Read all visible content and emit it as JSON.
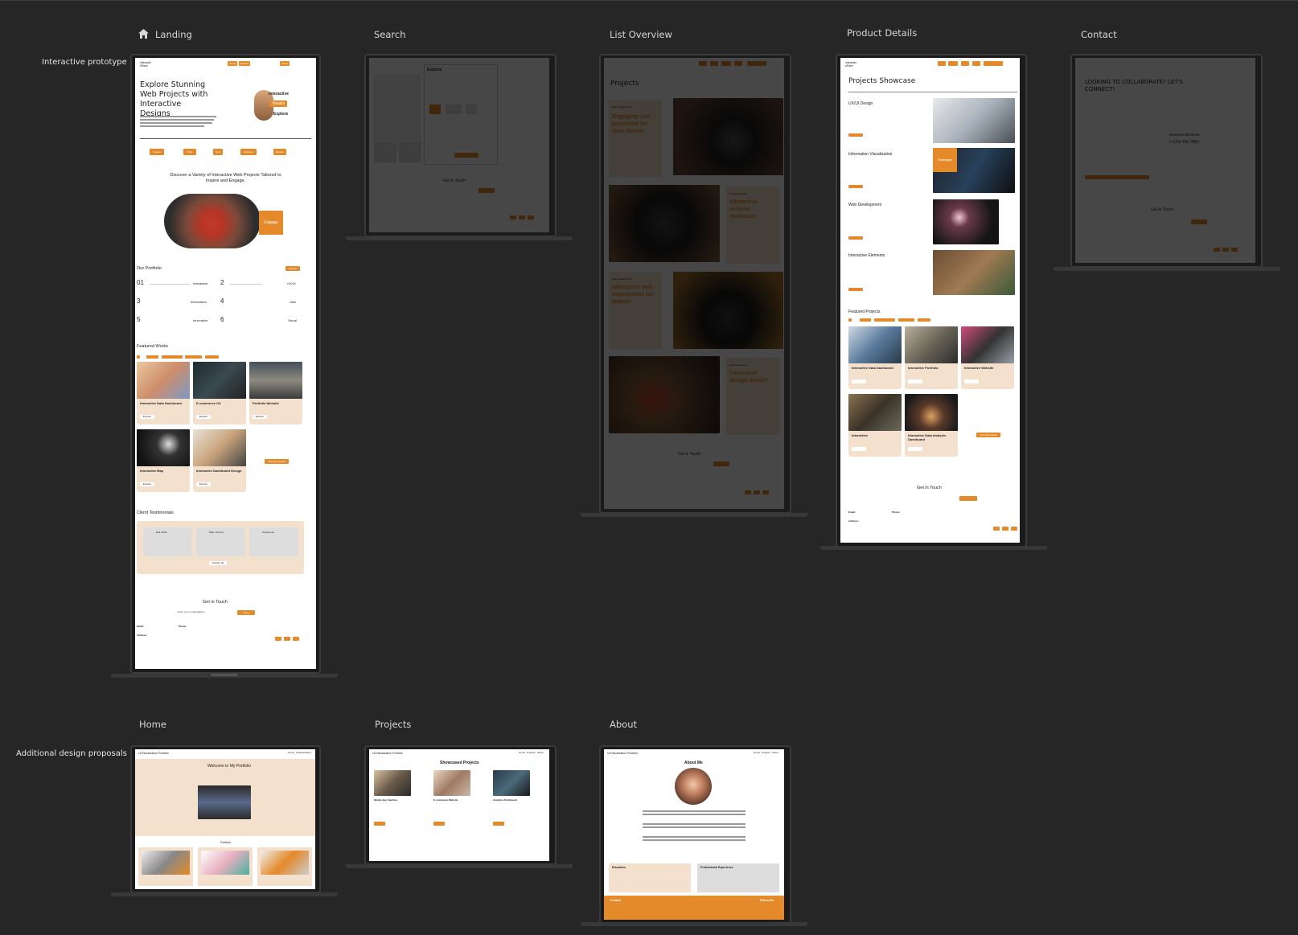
{
  "rows": {
    "interactive": "Interactive prototype",
    "additional": "Additional design proposals"
  },
  "sections": {
    "landing": "Landing",
    "search": "Search",
    "list_overview": "List Overview",
    "product_details": "Product Details",
    "contact": "Contact",
    "home": "Home",
    "projects": "Projects",
    "about": "About"
  },
  "colors": {
    "accent": "#e48a2a",
    "peach": "#f3e1cd",
    "canvas": "#262626"
  },
  "landing": {
    "brand": "interactiv sPace",
    "nav": [
      "Home",
      "Projects",
      "About"
    ],
    "hero_title": "Explore Stunning Web Projects with Interactive Designs",
    "hero_badges": [
      "Interactive",
      "Visuals",
      "Explore"
    ],
    "tools": [
      "Search",
      "Filter",
      "Sort",
      "Discover",
      "Explore"
    ],
    "discover": "Discover a Variety of Interactive Web Projects Tailored to Inspire and Engage.",
    "engage": "Engage",
    "portfolio_title": "Our Portfolio",
    "portfolio_btn": "Explore",
    "portfolio": [
      {
        "n": "01",
        "label": "Interactive"
      },
      {
        "n": "2",
        "label": "UX/UI"
      },
      {
        "n": "3",
        "label": "Information"
      },
      {
        "n": "4",
        "label": "User"
      },
      {
        "n": "5",
        "label": "Innovative"
      },
      {
        "n": "6",
        "label": "Visual"
      }
    ],
    "featured_title": "Featured Works",
    "works": [
      "Interactive Data Dashboard",
      "E-commerce UX",
      "Portfolio Website",
      "Interactive Map",
      "Interactive Dashboard Design"
    ],
    "explore": "Explore",
    "view_all": "View all projects",
    "testimonials_title": "Client Testimonials",
    "testimonials": [
      "Eva Smith",
      "Mike Johnson",
      "Sophia Lee"
    ],
    "explore_all": "Explore all",
    "get_in_touch": "Get in Touch",
    "email_placeholder": "Enter your email address",
    "send": "Send",
    "email_label": "Email:",
    "phone_label": "Phone:",
    "address_label": "Address:"
  },
  "search": {
    "panel_title": "Explore",
    "get_in_touch": "Get in Touch"
  },
  "list": {
    "title": "Projects",
    "cards": [
      {
        "tag": "Data Visualization",
        "text": "Engaging user interfaces for data stories"
      },
      {
        "tag": "Creative Designs",
        "text": "Interactive website showcase"
      },
      {
        "tag": "Web Development",
        "text": "Interactive web experiences for brands"
      },
      {
        "tag": "User Experience",
        "text": "Innovative design launch"
      }
    ],
    "get_in_touch": "Get in Touch"
  },
  "details": {
    "title": "Projects Showcase",
    "items": [
      "UX/UI Design",
      "Information Visualization",
      "Web Development",
      "Interactive Elements"
    ],
    "strategies": "Strategies",
    "featured_title": "Featured Projects",
    "featured": [
      "Interactive Data Dashboard",
      "Interactive Portfolio",
      "Interactive Website",
      "Interactive",
      "Interactive Data Analysis Dashboard"
    ],
    "view_all": "View all projects",
    "get_in_touch": "Get in Touch",
    "email_label": "Email:",
    "phone_label": "Phone:",
    "address_label": "Address:"
  },
  "contact": {
    "headline": "LOOKING TO COLLABORATE? LET'S CONNECT!",
    "email": "developer@interac",
    "phone": "(+123) 456 7890",
    "get_in_touch": "Get in Touch"
  },
  "home": {
    "brand": "UI/Visualization Portfolio",
    "nav": [
      "Home",
      "Projects",
      "About"
    ],
    "welcome": "Welcome to My Portfolio",
    "portfolio": "Portfolio"
  },
  "projects_page": {
    "brand": "UI/Visualization Portfolio",
    "nav": [
      "Home",
      "Projects",
      "About"
    ],
    "title": "Showcased Projects",
    "cards": [
      "Mobile App Interface",
      "E-commerce Website",
      "Analytics Dashboard"
    ]
  },
  "about": {
    "brand": "UI/Visualization Portfolio",
    "nav": [
      "Home",
      "Projects",
      "About"
    ],
    "title": "About Me",
    "education": "Education",
    "experience": "Professional Experience",
    "contact": "Contact",
    "follow": "Follow Me"
  }
}
